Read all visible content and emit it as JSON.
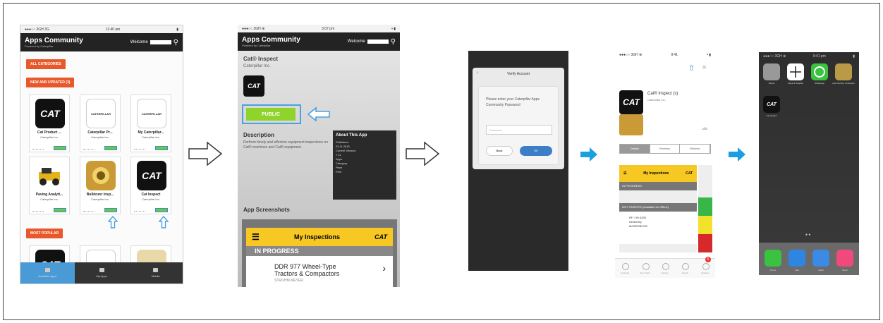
{
  "phone1": {
    "status": {
      "carrier": "●●●○○ 3GH 3G",
      "time": "11:40 am"
    },
    "header": {
      "title": "Apps Community",
      "subtitle": "Powered by Caterpillar",
      "welcome": "Welcome"
    },
    "btn_all_categories": "ALL CATEGORIES",
    "btn_new_and_updated": "NEW AND UPDATED (3)",
    "btn_most_popular": "MOST POPULAR",
    "tiles": [
      {
        "icon": "CAT",
        "name": "Cat Product ...",
        "company": "Caterpillar Inc."
      },
      {
        "icon": "CATERPILLAR",
        "name": "Caterpillar Pr...",
        "company": "Caterpillar Inc."
      },
      {
        "icon": "CATERPILLAR",
        "name": "My Caterpillar...",
        "company": "Caterpillar Inc."
      },
      {
        "icon": "",
        "name": "Paving Analyti...",
        "company": "Caterpillar Inc."
      },
      {
        "icon": "",
        "name": "Bulldozer Insp...",
        "company": "Caterpillar Inc."
      },
      {
        "icon": "CAT",
        "name": "Cat Inspect",
        "company": "Caterpillar Inc."
      }
    ],
    "bottom_tiles": [
      "CAT",
      "CATERPILLAR",
      ""
    ],
    "tabs": [
      "Available Apps",
      "My Apps",
      "Mobile"
    ]
  },
  "phone2": {
    "status": {
      "carrier": "●●●○○ 3GH ⊕",
      "time": "3:07 pm",
      "battery": "▪ ▮"
    },
    "header": {
      "title": "Apps Community",
      "subtitle": "Powered by Caterpillar",
      "welcome": "Welcome"
    },
    "app_name": "Cat® Inspect",
    "company": "Caterpillar Inc.",
    "public_button": "PUBLIC",
    "description_heading": "Description",
    "description_text": "Perform timely and effective equipment inspections on Cat® machines and Cat® equipment.",
    "about": {
      "heading": "About This App",
      "lines": [
        "Published:",
        "03.11.2015",
        "Current Version:",
        "7.11",
        "Apps",
        "Category",
        "Price",
        "Free"
      ]
    },
    "screenshots_heading": "App Screenshots",
    "screenshot": {
      "bar": "My Inspections",
      "logo": "CAT",
      "section": "IN PROGRESS",
      "row_line1": "DDR 977 Wheel-Type",
      "row_line2": "Tractors & Compactors",
      "row_line3": "STROHM MEYER"
    }
  },
  "phone3": {
    "dialog_title": "Verify Account",
    "message": "Please enter your Caterpillar Apps Community Password",
    "placeholder": "Password",
    "cancel": "Back",
    "ok": "OK"
  },
  "phone4": {
    "status": {
      "carrier": "●●●○○ 3GH ⊕",
      "time": "9:41",
      "battery": "▪ ▮"
    },
    "app_title": "Cat® Inspect (s)",
    "company": "Caterpillar Inc.",
    "icon": "CAT",
    "segments": [
      "Details",
      "Reviews",
      "Related"
    ],
    "shot": {
      "bar": "My Inspections",
      "logo": "CAT",
      "section": "IN PROGRESS",
      "row2": "NOT STARTED (Available for Offline)",
      "row_a": "RF / 3H 4295",
      "row_b": "Kimberley",
      "row_c": "MORESBOOK"
    },
    "tabs": [
      "Featured",
      "Top Charts",
      "Explore",
      "Search",
      "Updates"
    ],
    "update_badge": "6"
  },
  "phone5": {
    "status": {
      "carrier": "●●●○○ 3GH ⊕",
      "time": "9:41 pm",
      "battery": "▮"
    },
    "apps": [
      "Extras",
      "Clock & Weather",
      "WhatsApp",
      "Auto Service Contractor",
      "Cat Inspect"
    ],
    "dock": [
      "Phone",
      "Mail",
      "Safari",
      "Music"
    ]
  },
  "colors": {
    "accent_orange": "#e8582a",
    "accent_blue": "#4ba0e0",
    "cat_yellow": "#f7c823",
    "public_green": "#8fd42a"
  }
}
